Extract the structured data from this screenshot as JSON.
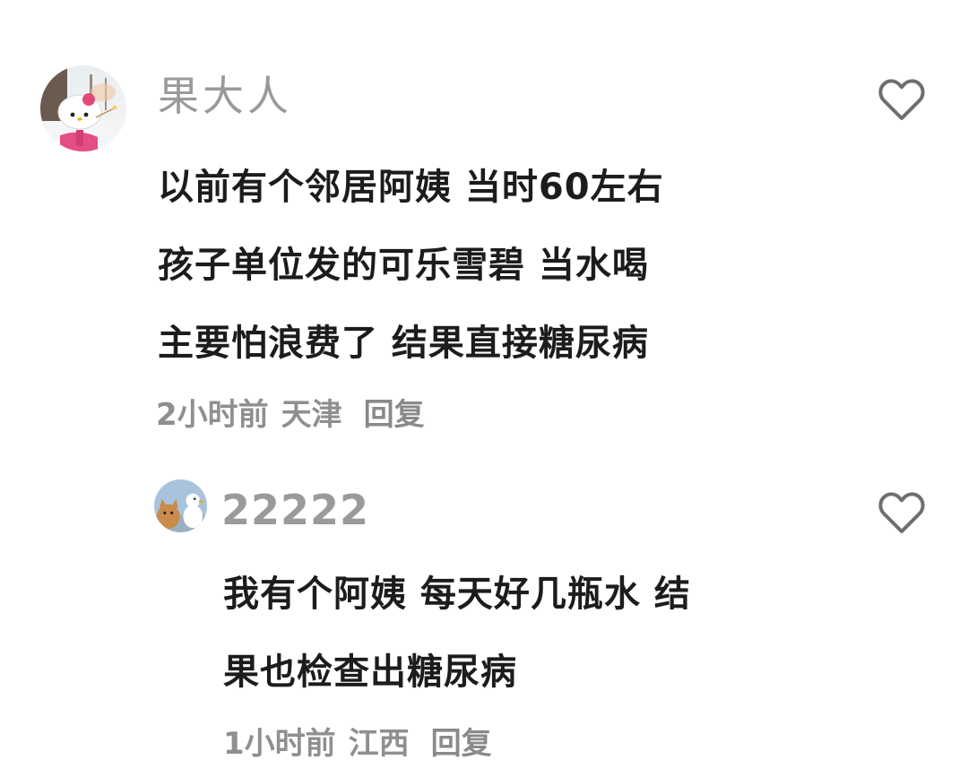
{
  "comments": [
    {
      "username": "果大人",
      "avatar_icon": "hello-kitty-avatar",
      "lines": [
        "以前有个邻居阿姨 当时60左右",
        "孩子单位发的可乐雪碧 当水喝",
        "主要怕浪费了 结果直接糖尿病"
      ],
      "time": "2小时前",
      "location": "天津",
      "reply_label": "回复",
      "like_icon": "heart-outline-icon"
    },
    {
      "username": "22222",
      "avatar_icon": "cat-and-duck-avatar",
      "lines": [
        "我有个阿姨 每天好几瓶水 结",
        "果也检查出糖尿病"
      ],
      "time": "1小时前",
      "location": "江西",
      "reply_label": "回复",
      "like_icon": "heart-outline-icon"
    }
  ],
  "colors": {
    "username": "#9a9a9a",
    "text": "#1c1c1c",
    "meta": "#8f8f8f",
    "heart": "#6e6e6e"
  }
}
